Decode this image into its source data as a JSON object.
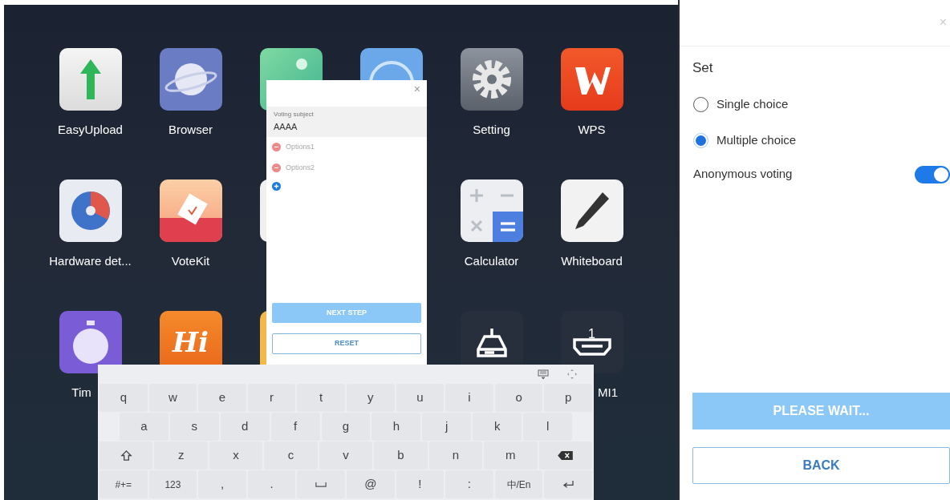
{
  "apps": [
    {
      "label": "EasyUpload",
      "kind": "upload"
    },
    {
      "label": "Browser",
      "kind": "planet"
    },
    {
      "kind": "green"
    },
    {
      "kind": "blue"
    },
    {
      "label": "Setting",
      "kind": "gear"
    },
    {
      "label": "WPS",
      "kind": "wps"
    },
    {
      "label": "Hardware det...",
      "kind": "gauge"
    },
    {
      "label": "VoteKit",
      "kind": "vote"
    },
    {
      "kind": "white"
    },
    {
      "kind": "none"
    },
    {
      "label": "Calculator",
      "kind": "calc"
    },
    {
      "label": "Whiteboard",
      "kind": "pen"
    },
    {
      "label": "Tim",
      "kind": "timer"
    },
    {
      "kind": "hi",
      "text": "Hi"
    },
    {
      "kind": "folder"
    },
    {
      "kind": "none"
    },
    {
      "kind": "box"
    },
    {
      "label": "MI1",
      "kind": "hdmi",
      "text": "1"
    }
  ],
  "vote_dialog": {
    "close": "×",
    "subject_label": "Voting subject",
    "subject_value": "AAAA",
    "options": [
      {
        "placeholder": "Options1"
      },
      {
        "placeholder": "Options2"
      }
    ],
    "next_button": "NEXT STEP",
    "reset_button": "RESET"
  },
  "keyboard": {
    "rows": [
      [
        {
          "kind": "char",
          "label": "q"
        },
        {
          "kind": "char",
          "label": "w"
        },
        {
          "kind": "char",
          "label": "e"
        },
        {
          "kind": "char",
          "label": "r"
        },
        {
          "kind": "char",
          "label": "t"
        },
        {
          "kind": "char",
          "label": "y"
        },
        {
          "kind": "char",
          "label": "u"
        },
        {
          "kind": "char",
          "label": "i"
        },
        {
          "kind": "char",
          "label": "o"
        },
        {
          "kind": "char",
          "label": "p"
        }
      ],
      [
        {
          "kind": "char",
          "label": "a"
        },
        {
          "kind": "char",
          "label": "s"
        },
        {
          "kind": "char",
          "label": "d"
        },
        {
          "kind": "char",
          "label": "f"
        },
        {
          "kind": "char",
          "label": "g"
        },
        {
          "kind": "char",
          "label": "h"
        },
        {
          "kind": "char",
          "label": "j"
        },
        {
          "kind": "char",
          "label": "k"
        },
        {
          "kind": "char",
          "label": "l"
        }
      ],
      [
        {
          "kind": "shift"
        },
        {
          "kind": "char",
          "label": "z"
        },
        {
          "kind": "char",
          "label": "x"
        },
        {
          "kind": "char",
          "label": "c"
        },
        {
          "kind": "char",
          "label": "v"
        },
        {
          "kind": "char",
          "label": "b"
        },
        {
          "kind": "char",
          "label": "n"
        },
        {
          "kind": "char",
          "label": "m"
        },
        {
          "kind": "backspace"
        }
      ],
      [
        {
          "kind": "char",
          "label": "#+="
        },
        {
          "kind": "char",
          "label": "123"
        },
        {
          "kind": "char",
          "label": ","
        },
        {
          "kind": "char",
          "label": "."
        },
        {
          "kind": "space"
        },
        {
          "kind": "char",
          "label": "@"
        },
        {
          "kind": "char",
          "label": "!"
        },
        {
          "kind": "char",
          "label": ":"
        },
        {
          "kind": "char",
          "label": "中/En"
        },
        {
          "kind": "enter"
        }
      ]
    ]
  },
  "settings_panel": {
    "close": "×",
    "title": "Set",
    "choices": [
      {
        "label": "Single choice",
        "selected": false
      },
      {
        "label": "Multiple choice",
        "selected": true
      }
    ],
    "anonymous": {
      "label": "Anonymous voting",
      "on": true
    },
    "wait_button": "PLEASE WAIT...",
    "back_button": "BACK"
  }
}
